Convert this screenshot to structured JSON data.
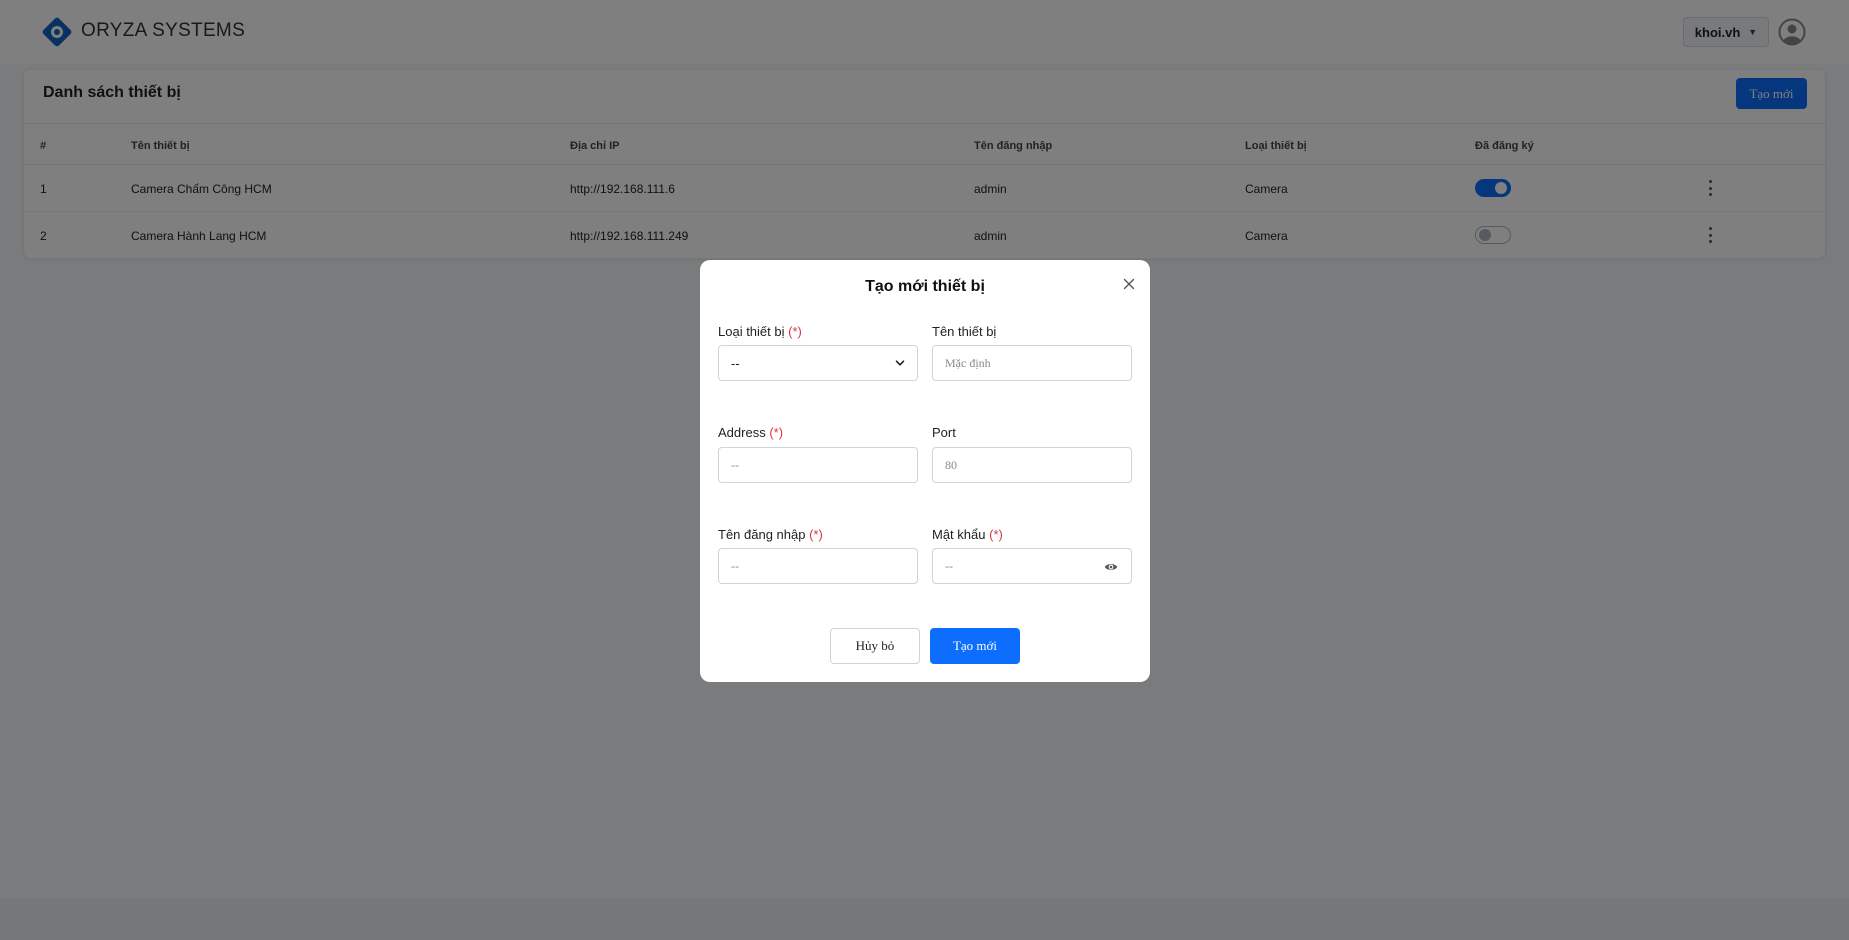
{
  "header": {
    "brand": "ORYZA SYSTEMS",
    "user": "khoi.vh",
    "caret": "▼"
  },
  "device_list": {
    "title": "Danh sách thiết bị",
    "create_label": "Tạo mới",
    "columns": [
      "#",
      "Tên thiết bị",
      "Địa chỉ IP",
      "Tên đăng nhập",
      "Loại thiết bị",
      "Đã đăng ký"
    ],
    "rows": [
      {
        "index": "1",
        "name": "Camera Chấm Công HCM",
        "ip": "http://192.168.111.6",
        "username": "admin",
        "type": "Camera",
        "registered": true
      },
      {
        "index": "2",
        "name": "Camera Hành Lang HCM",
        "ip": "http://192.168.111.249",
        "username": "admin",
        "type": "Camera",
        "registered": false
      }
    ]
  },
  "modal": {
    "title": "Tạo mới thiết bị",
    "required_mark": "(*)",
    "device_type": {
      "label": "Loại thiết bị",
      "value": "--"
    },
    "device_name": {
      "label": "Tên thiết bị",
      "placeholder": "Mặc định"
    },
    "address": {
      "label": "Address",
      "placeholder": "--"
    },
    "port": {
      "label": "Port",
      "placeholder": "80"
    },
    "username": {
      "label": "Tên đăng nhập",
      "placeholder": "--"
    },
    "password": {
      "label": "Mật khẩu",
      "placeholder": "--"
    },
    "cancel_label": "Hủy bỏ",
    "submit_label": "Tạo mới"
  },
  "colors": {
    "primary": "#0d6efd",
    "required": "#dc3545",
    "brand_icon": "#1565c0",
    "backdrop": "rgba(0,0,0,0.5)"
  },
  "icons": [
    "oryza-logo-icon",
    "avatar-icon",
    "kebab-menu-icon",
    "close-icon",
    "chevron-down-icon",
    "eye-icon"
  ]
}
